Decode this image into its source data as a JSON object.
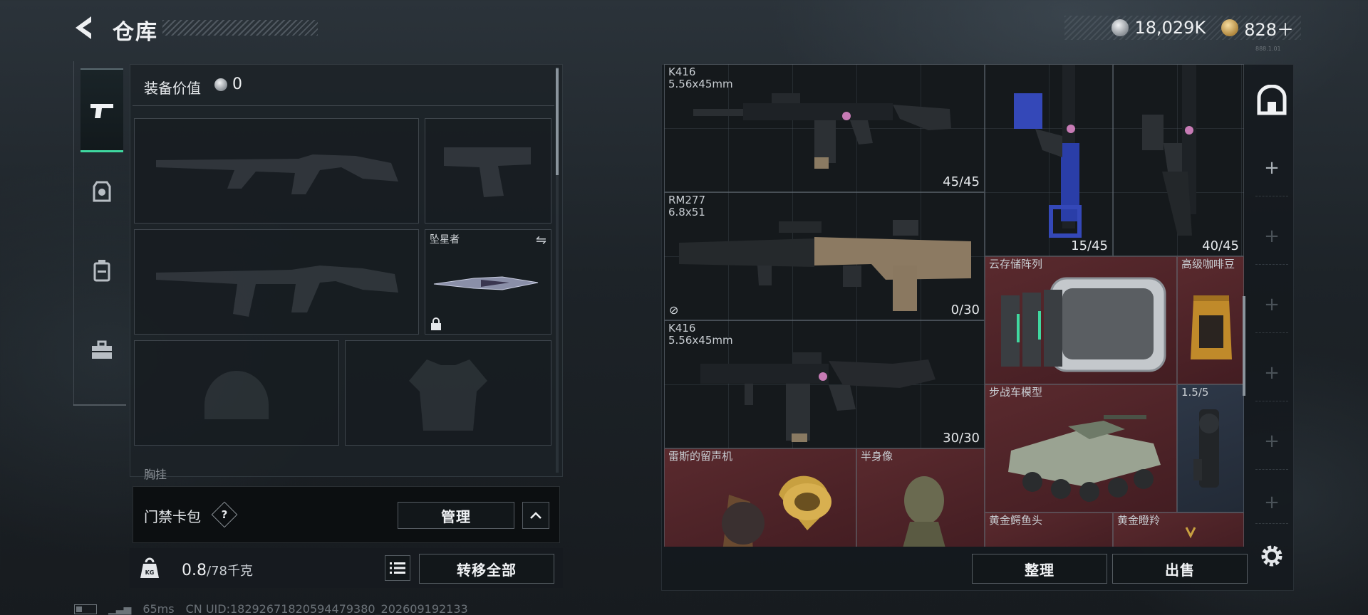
{
  "header": {
    "title": "仓库"
  },
  "currency": {
    "coins": "18,029K",
    "premium": "828＋",
    "tiny_text": "888.1.01"
  },
  "sidebar": {
    "tabs": [
      {
        "name": "pistol-icon",
        "active": true
      },
      {
        "name": "armor-icon"
      },
      {
        "name": "backpack-icon"
      },
      {
        "name": "case-icon"
      }
    ]
  },
  "loadout": {
    "value_label": "装备价值",
    "value": "0",
    "melee_name": "坠星者",
    "partial_label": "胸挂",
    "keycard_label": "门禁卡包",
    "help": "?",
    "manage_label": "管理",
    "weight_value": "0.8",
    "weight_max": "/78千克",
    "weight_icon_text": "KG",
    "transfer_label": "转移全部"
  },
  "stash": {
    "items": [
      {
        "name": "K416\n5.56x45mm",
        "count": "45/45",
        "color": "dark"
      },
      {
        "name": "RM277\n6.8x51",
        "count": "0/30",
        "color": "dark"
      },
      {
        "name": "K416\n5.56x45mm",
        "count": "30/30",
        "color": "dark"
      },
      {
        "name": "",
        "count": "15/45",
        "color": "dark"
      },
      {
        "name": "",
        "count": "40/45",
        "color": "dark"
      },
      {
        "name": "云存储阵列",
        "count": "",
        "color": "red"
      },
      {
        "name": "高级咖啡豆",
        "count": "",
        "color": "red"
      },
      {
        "name": "步战车模型",
        "count": "",
        "color": "red"
      },
      {
        "name": "1.5/5",
        "count": "",
        "color": "blue"
      },
      {
        "name": "雷斯的留声机",
        "count": "",
        "color": "red"
      },
      {
        "name": "半身像",
        "count": "",
        "color": "red"
      },
      {
        "name": "黄金鳄鱼头",
        "count": "",
        "color": "red"
      },
      {
        "name": "黄金瞪羚",
        "count": "",
        "color": "red"
      }
    ],
    "sort_label": "整理",
    "sell_label": "出售"
  },
  "status": {
    "ping": "65ms",
    "uid": "CN UID:18292671820594479380_202609192133"
  },
  "colors": {
    "accent_green": "#3fd8a0",
    "item_red": "#5a2a2e",
    "item_blue": "#2e3848"
  }
}
